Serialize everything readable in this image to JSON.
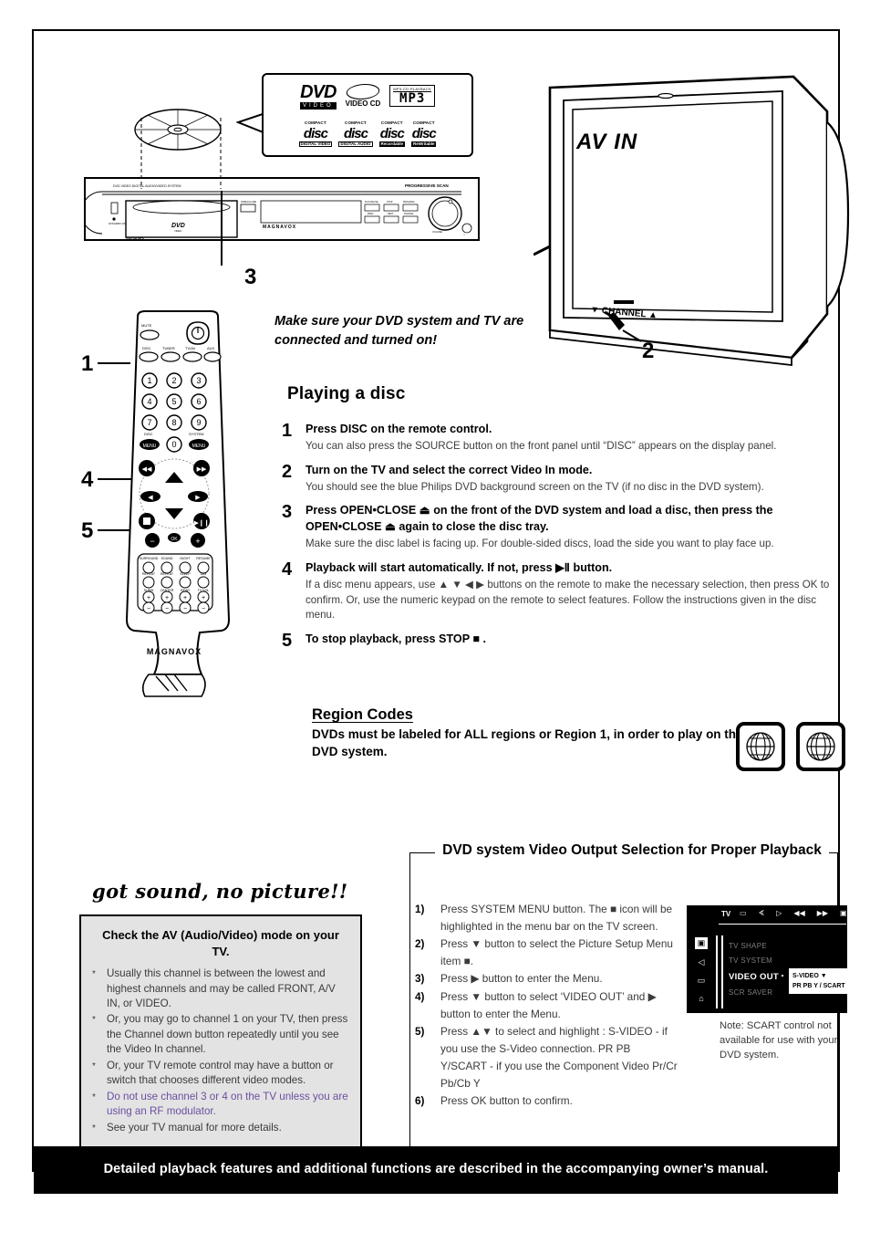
{
  "logos": {
    "dvd": {
      "main": "DVD",
      "sub": "VIDEO"
    },
    "video_cd": "VIDEO CD",
    "mp3": {
      "top": "MP3-CD PLAYBACK",
      "main": "MP3"
    },
    "cds": [
      {
        "compact": "COMPACT",
        "disc": "disc",
        "sub": "DIGITAL VIDEO",
        "inverted": false
      },
      {
        "compact": "COMPACT",
        "disc": "disc",
        "sub": "DIGITAL AUDIO",
        "inverted": false
      },
      {
        "compact": "COMPACT",
        "disc": "disc",
        "sub": "Recordable",
        "inverted": true
      },
      {
        "compact": "COMPACT",
        "disc": "disc",
        "sub": "ReWritable",
        "inverted": true
      }
    ]
  },
  "tv": {
    "screen_label": "AV IN",
    "channel_label": "CHANNEL"
  },
  "unit": {
    "brand": "MAGNAVOX",
    "progressive": "PROGRESSIVE SCAN",
    "disc_label": "DVD VIDEO"
  },
  "remote": {
    "brand": "MAGNAVOX"
  },
  "callouts": {
    "n1": "1",
    "n2": "2",
    "n3": "3",
    "n4": "4",
    "n5": "5"
  },
  "intro": "Make sure your DVD system and TV are connected and turned on!",
  "playing": {
    "title": "Playing a disc",
    "steps": [
      {
        "num": "1",
        "head": "Press DISC on the remote control.",
        "desc": "You can also press the SOURCE button on the front panel until “DISC” appears on the display panel."
      },
      {
        "num": "2",
        "head": "Turn on the TV and select the correct Video In mode.",
        "desc": "You should see the blue Philips DVD background screen on the TV (if no disc in the DVD system)."
      },
      {
        "num": "3",
        "head": "Press OPEN•CLOSE ⏏ on the front of the DVD system and load a disc, then press the OPEN•CLOSE ⏏ again to close the disc tray.",
        "desc": "Make sure the disc label is facing up.  For double-sided discs, load the side you want to play face up."
      },
      {
        "num": "4",
        "head": "Playback will start automatically.  If not, press  ▶Ⅱ button.",
        "desc": "If a disc menu appears, use ▲ ▼ ◀ ▶ buttons on the remote to make the necessary selection, then press OK to confirm.  Or, use the numeric keypad on the remote to select features.  Follow the instructions given in the disc menu."
      },
      {
        "num": "5",
        "head": "To stop playback, press STOP ■ .",
        "desc": ""
      }
    ]
  },
  "region": {
    "title": "Region Codes",
    "text": "DVDs must be labeled for ALL regions or Region 1, in order to play on this DVD system."
  },
  "got_sound": {
    "headline": "got sound, no picture!!",
    "box_title": "Check the AV (Audio/Video) mode on your TV.",
    "bullets": [
      {
        "text": "Usually this channel is between the lowest and highest channels and may be called FRONT, A/V IN, or VIDEO.",
        "purple": false
      },
      {
        "text": "Or, you may go to channel 1 on your TV, then press the Channel down button repeatedly until you see the Video In channel.",
        "purple": false
      },
      {
        "text": "Or, your TV remote control may have a button or switch that chooses different video modes.",
        "purple": false
      },
      {
        "text": "Do not use channel 3 or 4 on the TV unless you are using an RF modulator.",
        "purple": true
      },
      {
        "text": "See your TV manual for more details.",
        "purple": false
      }
    ],
    "bullet_marker": "*",
    "purple_color": "#6b4fa0"
  },
  "video_out": {
    "title": "DVD system Video Output Selection for Proper Playback",
    "steps": [
      {
        "num": "1)",
        "text": "Press SYSTEM MENU button. The ■ icon will be highlighted in the menu bar on the TV screen."
      },
      {
        "num": "2)",
        "text": "Press ▼ button to select the Picture Setup Menu item ■."
      },
      {
        "num": "3)",
        "text": "Press ▶ button to enter the Menu."
      },
      {
        "num": "4)",
        "text": "Press ▼ button to select ‘VIDEO OUT’ and ▶ button to enter the Menu."
      },
      {
        "num": "5)",
        "text": "Press ▲▼ to select and highlight : S-VIDEO - if you use the S-Video connection. PR PB Y/SCART - if you use the Component Video Pr/Cr Pb/Cb Y"
      },
      {
        "num": "6)",
        "text": "Press OK button to confirm."
      }
    ],
    "menu": {
      "title_label": "TV",
      "items": [
        "TV SHAPE",
        "TV SYSTEM",
        "VIDEO OUT",
        "SCR SAVER"
      ],
      "highlighted": "VIDEO OUT",
      "popup": [
        "S-VIDEO ▼",
        "PR PB Y / SCART"
      ]
    },
    "note": "Note:  SCART control not available for use with your DVD system."
  },
  "footer": "Detailed playback features and additional functions are described in the accompanying owner’s manual."
}
